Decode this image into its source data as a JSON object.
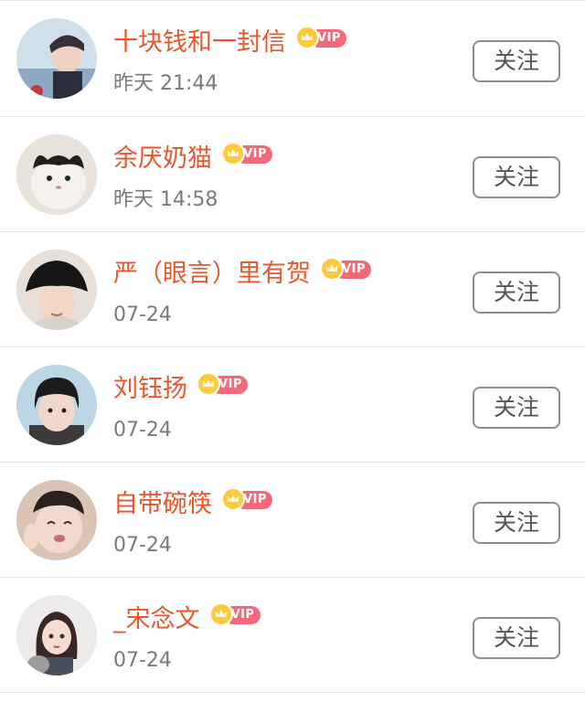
{
  "follow_label": "关注",
  "vip_label": "VIP",
  "users": [
    {
      "name": "十块钱和一封信",
      "time": "昨天 21:44",
      "avatar": "boy-photo-avatar"
    },
    {
      "name": "余厌奶猫",
      "time": "昨天 14:58",
      "avatar": "cat-photo-avatar"
    },
    {
      "name": "严（眼言）里有贺",
      "time": "07-24",
      "avatar": "bucket-hat-photo-avatar"
    },
    {
      "name": "刘钰扬",
      "time": "07-24",
      "avatar": "boy-bowl-cut-avatar"
    },
    {
      "name": "自带碗筷",
      "time": "07-24",
      "avatar": "crying-face-avatar"
    },
    {
      "name": "_宋念文",
      "time": "07-24",
      "avatar": "anime-girl-with-cat-avatar"
    }
  ],
  "colors": {
    "name": "#e8562a",
    "time": "#7a7a7a",
    "vip_badge": "#f1697a",
    "crown": "#ffc93c",
    "button_border": "#8d8d8d"
  }
}
